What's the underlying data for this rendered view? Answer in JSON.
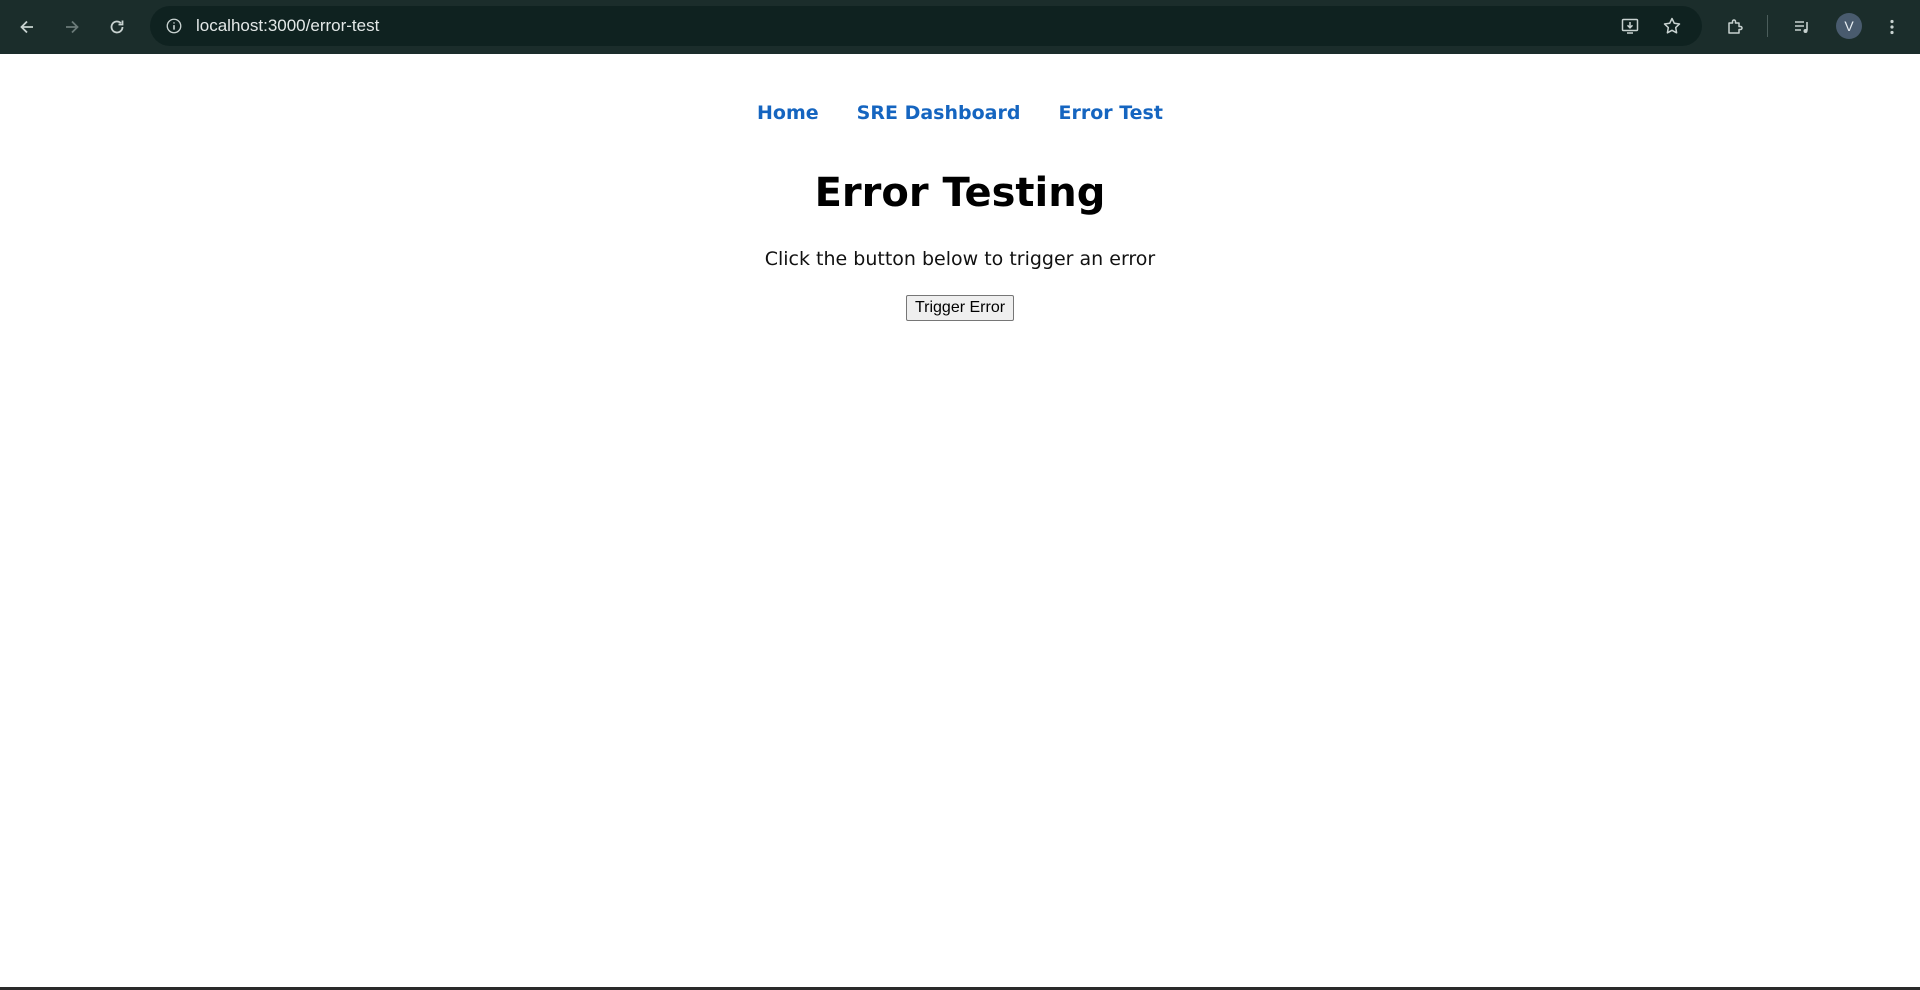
{
  "browser": {
    "url": "localhost:3000/error-test",
    "profile_initial": "V",
    "icons": {
      "back": "back-arrow-icon",
      "forward": "forward-arrow-icon",
      "reload": "reload-icon",
      "info": "site-info-icon",
      "install": "install-app-icon",
      "bookmark": "star-icon",
      "extensions": "puzzle-icon",
      "media": "media-control-icon",
      "menu": "kebab-menu-icon"
    }
  },
  "nav": {
    "items": [
      {
        "label": "Home"
      },
      {
        "label": "SRE Dashboard"
      },
      {
        "label": "Error Test"
      }
    ]
  },
  "main": {
    "title": "Error Testing",
    "description": "Click the button below to trigger an error",
    "button_label": "Trigger Error"
  },
  "colors": {
    "toolbar": "#1b2d2b",
    "omnibox": "#0f2220",
    "link": "#1565c0"
  }
}
